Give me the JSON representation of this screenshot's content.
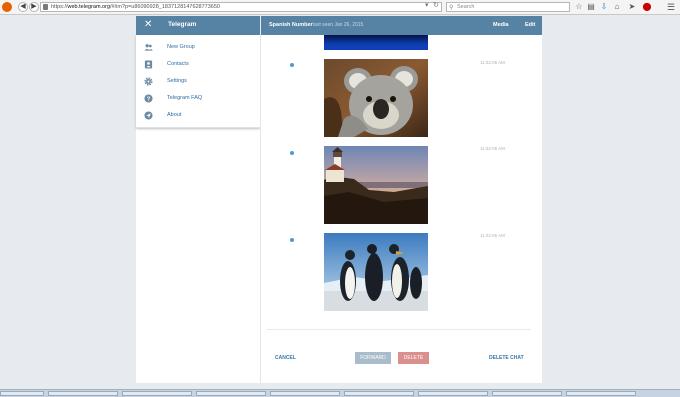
{
  "browser": {
    "url_scheme": "https://",
    "url_host": "web.telegram.org",
    "url_path": "/#/im?p=u86090928_1837128147628773650",
    "search_placeholder": "Search"
  },
  "menu": {
    "title": "Telegram",
    "items": [
      {
        "label": "New Group",
        "icon": "new-group-icon"
      },
      {
        "label": "Contacts",
        "icon": "contacts-icon"
      },
      {
        "label": "Settings",
        "icon": "settings-icon"
      },
      {
        "label": "Telegram FAQ",
        "icon": "help-icon"
      },
      {
        "label": "About",
        "icon": "send-icon"
      }
    ]
  },
  "chat_header": {
    "peer_name": "Spanish Number",
    "status": "last seen Jan 26, 2015",
    "media_label": "Media",
    "edit_label": "Edit"
  },
  "messages": [
    {
      "time": "11:32:06 AM",
      "photo": "koala"
    },
    {
      "time": "11:32:06 AM",
      "photo": "lighthouse"
    },
    {
      "time": "11:32:06 AM",
      "photo": "penguins"
    }
  ],
  "actions": {
    "cancel": "CANCEL",
    "forward": "FORWARD",
    "delete": "DELETE",
    "delete_chat": "DELETE CHAT"
  },
  "colors": {
    "header": "#5682a3",
    "link": "#2e6da4",
    "select_dot": "#4f9ad6",
    "delete": "#db8e8e",
    "forward": "#a8bccb"
  }
}
